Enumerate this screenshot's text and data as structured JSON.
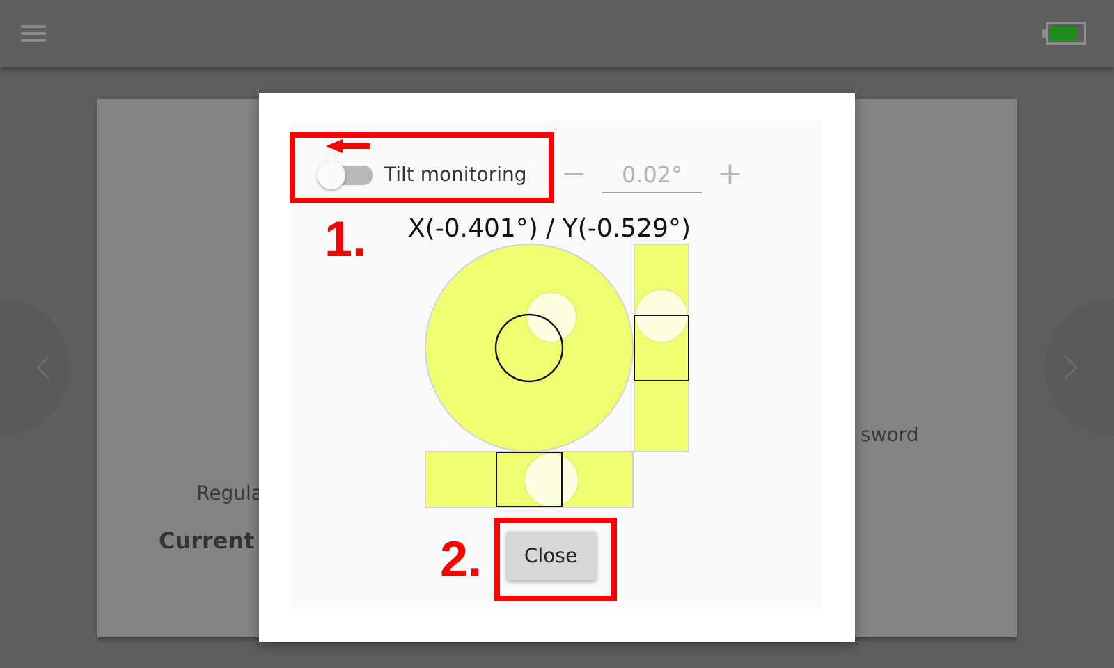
{
  "background_card": {
    "texts": [
      {
        "kind": "label",
        "text": "Regula"
      },
      {
        "kind": "heading",
        "text": "Current"
      },
      {
        "kind": "label",
        "text": "sword"
      }
    ]
  },
  "dialog": {
    "toggle": {
      "label": "Tilt monitoring",
      "on": false
    },
    "stepper": {
      "minus": "−",
      "value": "0.02°",
      "plus": "+",
      "disabled": true
    },
    "reading": "X(-0.401°) / Y(-0.529°)",
    "close_button": "Close",
    "annotations": [
      "1.",
      "2."
    ]
  }
}
